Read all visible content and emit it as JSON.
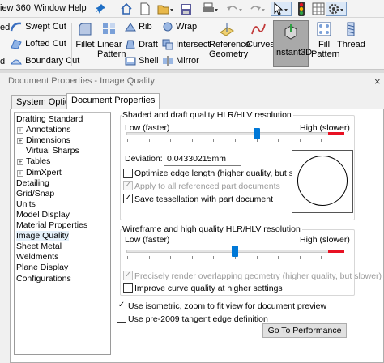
{
  "menu": {
    "items": [
      "iew 360",
      "Window",
      "Help"
    ]
  },
  "quick_access": {
    "icons": [
      "pin-icon",
      "home-icon",
      "new-document-icon",
      "open-icon",
      "save-icon",
      "print-icon",
      "undo-icon",
      "redo-icon",
      "select-cursor-icon",
      "traffic-light-icon",
      "options-grid-icon",
      "gear-icon"
    ]
  },
  "ribbon": {
    "swept_cut": "Swept Cut",
    "lofted_cut": "Lofted Cut",
    "boundary_cut": "Boundary Cut",
    "cut_prefix_1": "ed",
    "cut_prefix_3": "d",
    "fillet": "Fillet",
    "linear_pattern_1": "Linear",
    "linear_pattern_2": "Pattern",
    "rib": "Rib",
    "draft": "Draft",
    "shell": "Shell",
    "wrap": "Wrap",
    "intersect": "Intersect",
    "mirror": "Mirror",
    "reference_geometry_1": "Reference",
    "reference_geometry_2": "Geometry",
    "curves": "Curves",
    "instant3d": "Instant3D",
    "fill_pattern_1": "Fill",
    "fill_pattern_2": "Pattern",
    "thread": "Thread"
  },
  "dialog": {
    "title": "Document Properties - Image Quality",
    "close": "×",
    "tabs": [
      "System Options",
      "Document Properties"
    ],
    "active_tab": "Document Properties"
  },
  "tree": {
    "items": [
      {
        "label": "Drafting Standard",
        "expandable": false
      },
      {
        "label": "Annotations",
        "expandable": true
      },
      {
        "label": "Dimensions",
        "expandable": true
      },
      {
        "label": "Virtual Sharps",
        "expandable": false
      },
      {
        "label": "Tables",
        "expandable": true
      },
      {
        "label": "DimXpert",
        "expandable": true
      },
      {
        "label": "Detailing",
        "expandable": false
      },
      {
        "label": "Grid/Snap",
        "expandable": false
      },
      {
        "label": "Units",
        "expandable": false
      },
      {
        "label": "Model Display",
        "expandable": false
      },
      {
        "label": "Material Properties",
        "expandable": false
      },
      {
        "label": "Image Quality",
        "expandable": false
      },
      {
        "label": "Sheet Metal",
        "expandable": false
      },
      {
        "label": "Weldments",
        "expandable": false
      },
      {
        "label": "Plane Display",
        "expandable": false
      },
      {
        "label": "Configurations",
        "expandable": false
      }
    ],
    "selected": "Image Quality"
  },
  "shaded": {
    "title": "Shaded and draft quality HLR/HLV resolution",
    "low_label": "Low (faster)",
    "high_label": "High (slower)",
    "slider_value": 0.6,
    "deviation_label": "Deviation:",
    "deviation_value": "0.04330215mm",
    "optimize_label": "Optimize edge length (higher quality, but slower)",
    "optimize_checked": false,
    "apply_label": "Apply to all referenced part documents",
    "apply_checked": true,
    "apply_disabled": true,
    "save_label": "Save tessellation with part document",
    "save_checked": true
  },
  "wireframe": {
    "title": "Wireframe and high quality HLR/HLV resolution",
    "low_label": "Low (faster)",
    "high_label": "High (slower)",
    "slider_value": 0.5,
    "precise_label": "Precisely render overlapping geometry (higher quality, but slower)",
    "precise_checked": true,
    "precise_disabled": true,
    "improve_label": "Improve curve quality at higher settings",
    "improve_checked": false
  },
  "options": {
    "isometric_label": "Use isometric, zoom to fit view for document preview",
    "isometric_checked": true,
    "pre2009_label": "Use pre-2009 tangent edge definition",
    "pre2009_checked": false,
    "performance_button": "Go To Performance"
  },
  "colors": {
    "accent": "#0078d7",
    "slider_high": "#e81123",
    "selected_bg": "#e5f1fb"
  }
}
